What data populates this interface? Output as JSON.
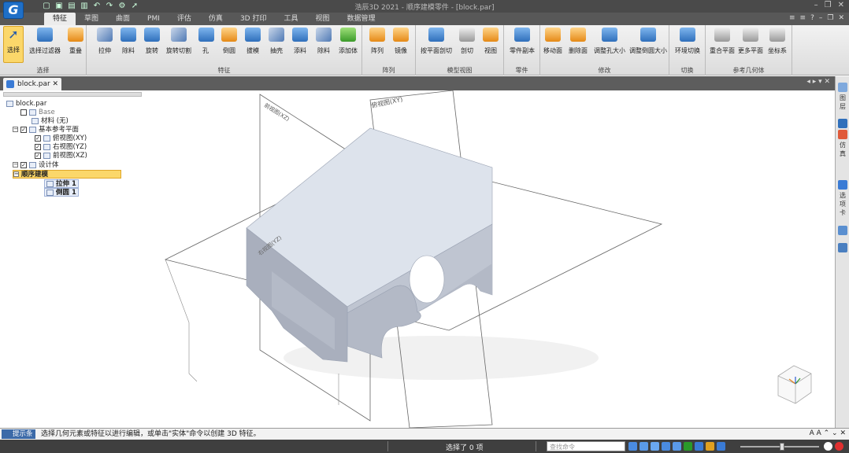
{
  "app": {
    "logo": "G",
    "title": "浩辰3D 2021 - 顺序建模零件 - [block.par]",
    "window_controls": [
      "–",
      "❐",
      "✕"
    ]
  },
  "tabs": [
    "特征",
    "草图",
    "曲面",
    "PMI",
    "评估",
    "仿真",
    "3D 打印",
    "工具",
    "视图",
    "数据管理"
  ],
  "tab_right": [
    "≡",
    "≡",
    "?",
    "–",
    "❐",
    "✕"
  ],
  "ribbon": {
    "groups": [
      {
        "label": "选择",
        "buttons": [
          "选择",
          "选择过滤器",
          "重叠"
        ]
      },
      {
        "label": "特征",
        "buttons": [
          "拉伸",
          "除料",
          "旋转",
          "旋转切割",
          "孔",
          "倒圆",
          "拔模",
          "抽壳",
          "添料",
          "除料",
          "添加体"
        ]
      },
      {
        "label": "阵列",
        "buttons": [
          "阵列",
          "镜像"
        ]
      },
      {
        "label": "模型视图",
        "buttons": [
          "按平面剖切",
          "剖切",
          "视图"
        ]
      },
      {
        "label": "零件",
        "buttons": [
          "零件副本"
        ]
      },
      {
        "label": "修改",
        "buttons": [
          "移动面",
          "删除面",
          "调整孔大小",
          "调整倒圆大小"
        ]
      },
      {
        "label": "切换",
        "buttons": [
          "环境切换"
        ]
      },
      {
        "label": "参考几何体",
        "buttons": [
          "重合平面",
          "更多平面",
          "坐标系"
        ]
      }
    ]
  },
  "document": {
    "tab_label": "block.par",
    "close": "✕",
    "right_controls": "◂ ▸ ▾ ✕"
  },
  "tree": {
    "root": "block.par",
    "base": "Base",
    "material": "材料 (无)",
    "ref_planes": "基本参考平面",
    "plane_xy": "俯视图(XY)",
    "plane_yz": "右视图(YZ)",
    "plane_xz": "前视图(XZ)",
    "design_body": "设计体",
    "sequential": "顺序建模",
    "feature1": "拉伸 1",
    "feature2": "倒圆 1",
    "expander_minus": "−",
    "check_mark": "✓"
  },
  "viewport": {
    "plane_labels": [
      "前视图(XZ)",
      "俯视图(XY)",
      "右视图(YZ)"
    ],
    "colors": {
      "body_top": "#dde3ec",
      "body_front": "#b9bfcc",
      "body_side": "#a6acbb",
      "plane": "#555555"
    }
  },
  "right_bar": [
    "图层",
    "仿真",
    "选项卡"
  ],
  "prompt": {
    "label": "提示条",
    "text": "选择几何元素或特征以进行编辑，或单击\"实体\"命令以创建 3D 特征。",
    "right": "A A ⌃ ⌄ ✕"
  },
  "status": {
    "selected": "选择了 0 项",
    "search_placeholder": "查找命令"
  }
}
